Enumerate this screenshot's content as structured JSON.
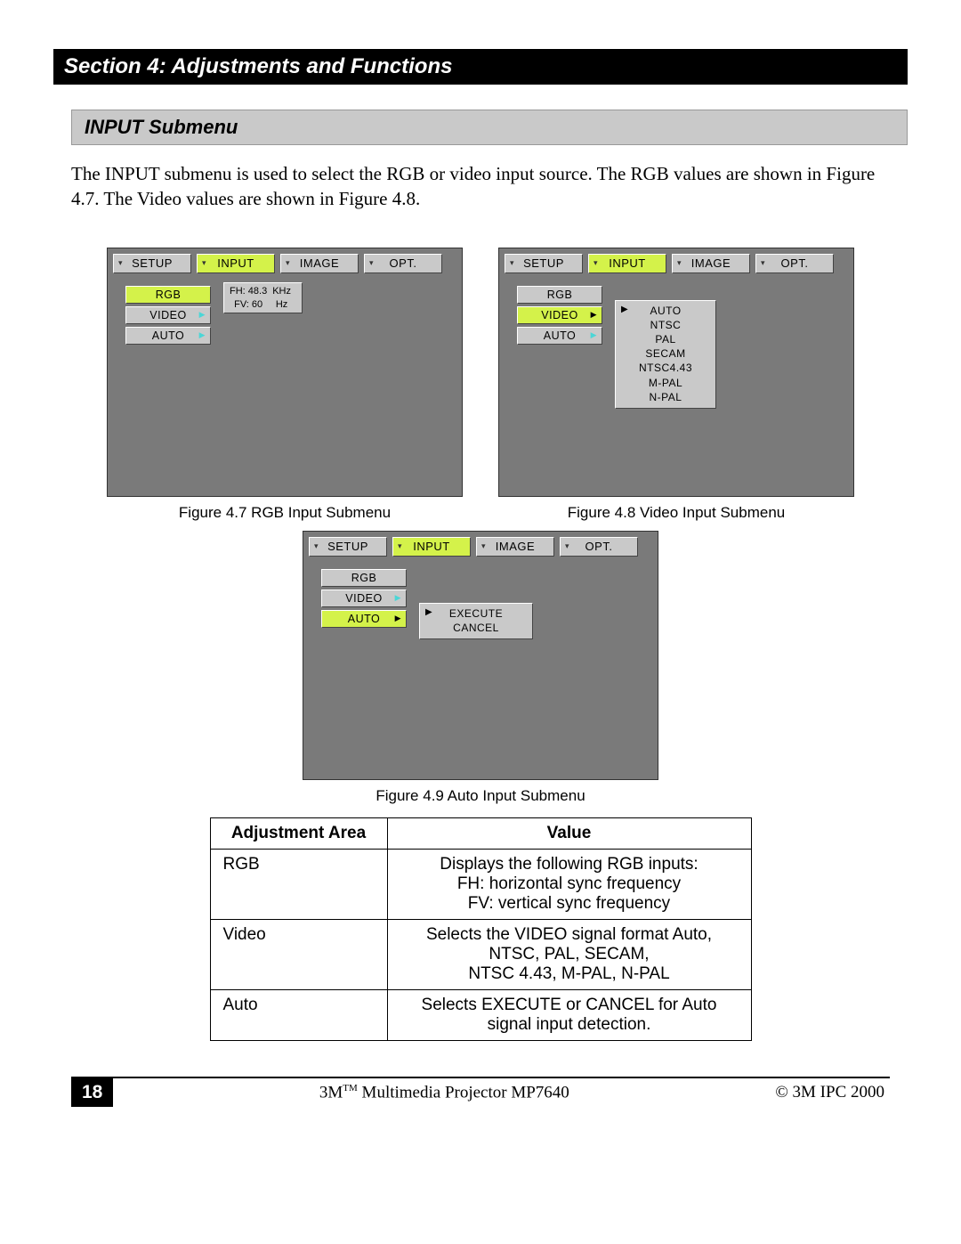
{
  "section_title": "Section 4: Adjustments and Functions",
  "subsection_title": "INPUT Submenu",
  "body_text": "The INPUT submenu is used to select the RGB or video input source. The RGB values are shown in Figure 4.7. The Video values are shown in Figure 4.8.",
  "tabs": {
    "setup": "SETUP",
    "input": "INPUT",
    "image": "IMAGE",
    "opt": "OPT."
  },
  "menu_items": {
    "rgb": "RGB",
    "video": "VIDEO",
    "auto": "AUTO"
  },
  "fig47": {
    "caption": "Figure 4.7 RGB Input Submenu",
    "info": {
      "fh_label": "FH: 48.3",
      "fh_unit": "KHz",
      "fv_label": "FV: 60",
      "fv_unit": "Hz"
    }
  },
  "fig48": {
    "caption": "Figure 4.8 Video Input Submenu",
    "options": [
      "AUTO",
      "NTSC",
      "PAL",
      "SECAM",
      "NTSC4.43",
      "M-PAL",
      "N-PAL"
    ]
  },
  "fig49": {
    "caption": "Figure 4.9 Auto Input Submenu",
    "options": [
      "EXECUTE",
      "CANCEL"
    ]
  },
  "table": {
    "h1": "Adjustment Area",
    "h2": "Value",
    "rows": [
      {
        "area": "RGB",
        "value": "Displays the following RGB inputs:\nFH:  horizontal sync frequency\nFV:  vertical sync frequency"
      },
      {
        "area": "Video",
        "value": "Selects the VIDEO signal format Auto, NTSC, PAL, SECAM,\nNTSC 4.43, M-PAL, N-PAL"
      },
      {
        "area": "Auto",
        "value": "Selects EXECUTE or CANCEL for Auto signal input detection."
      }
    ]
  },
  "footer": {
    "page": "18",
    "center_pre": "3M",
    "center_tm": "TM",
    "center_post": " Multimedia Projector MP7640",
    "right": "© 3M IPC 2000"
  }
}
